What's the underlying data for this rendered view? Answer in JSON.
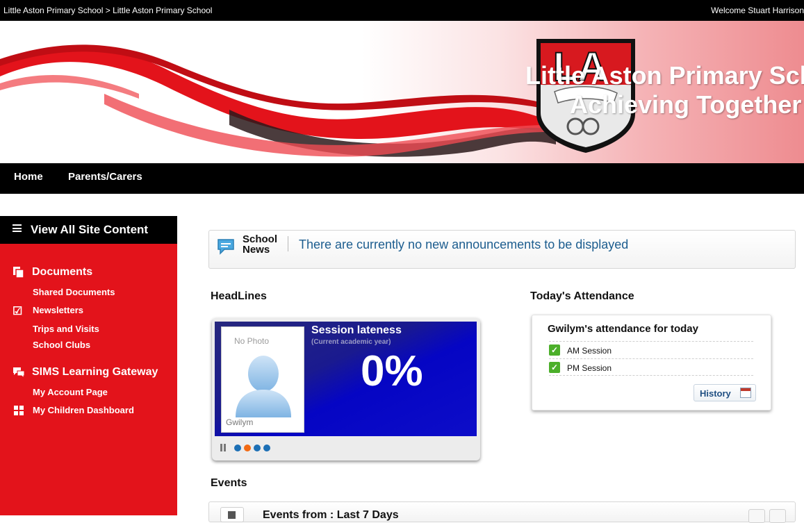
{
  "topbar": {
    "breadcrumb": "Little Aston Primary School > Little Aston Primary School",
    "welcome": "Welcome Stuart Harrison"
  },
  "banner": {
    "title": "Little Aston Primary School",
    "motto": "Achieving Together",
    "crest_letters": "LA"
  },
  "nav": {
    "items": [
      "Home",
      "Parents/Carers"
    ]
  },
  "sidebar": {
    "view_all": "View All Site Content",
    "sections": [
      {
        "title": "Documents",
        "icon": "documents-icon",
        "items": [
          "Shared Documents",
          "Newsletters",
          "Trips and Visits",
          "School Clubs"
        ]
      },
      {
        "title": "SIMS Learning Gateway",
        "icon": "chat-bubbles-icon",
        "items": [
          "My Account Page",
          "My Children Dashboard"
        ]
      }
    ]
  },
  "news": {
    "label_line1": "School",
    "label_line2": "News",
    "message": "There are currently no new announcements to be displayed"
  },
  "headlines": {
    "heading": "HeadLines",
    "photo_placeholder": "No Photo",
    "student_name": "Gwilym",
    "title": "Session lateness",
    "subtitle": "(Current academic year)",
    "value": "0%",
    "carousel_active_index": 1,
    "carousel_count": 4
  },
  "attendance": {
    "heading": "Today's Attendance",
    "title": "Gwilym's attendance for today",
    "sessions": [
      "AM Session",
      "PM Session"
    ],
    "history_label": "History"
  },
  "events": {
    "heading": "Events",
    "title": "Events from : Last 7 Days"
  },
  "colors": {
    "brand_red": "#e3131b",
    "nav_black": "#000000",
    "news_text": "#1c5d8f",
    "headline_blue": "#0505c4",
    "dot_blue": "#1c6fb5",
    "dot_orange": "#f26a14",
    "present_green": "#4caf2a"
  }
}
